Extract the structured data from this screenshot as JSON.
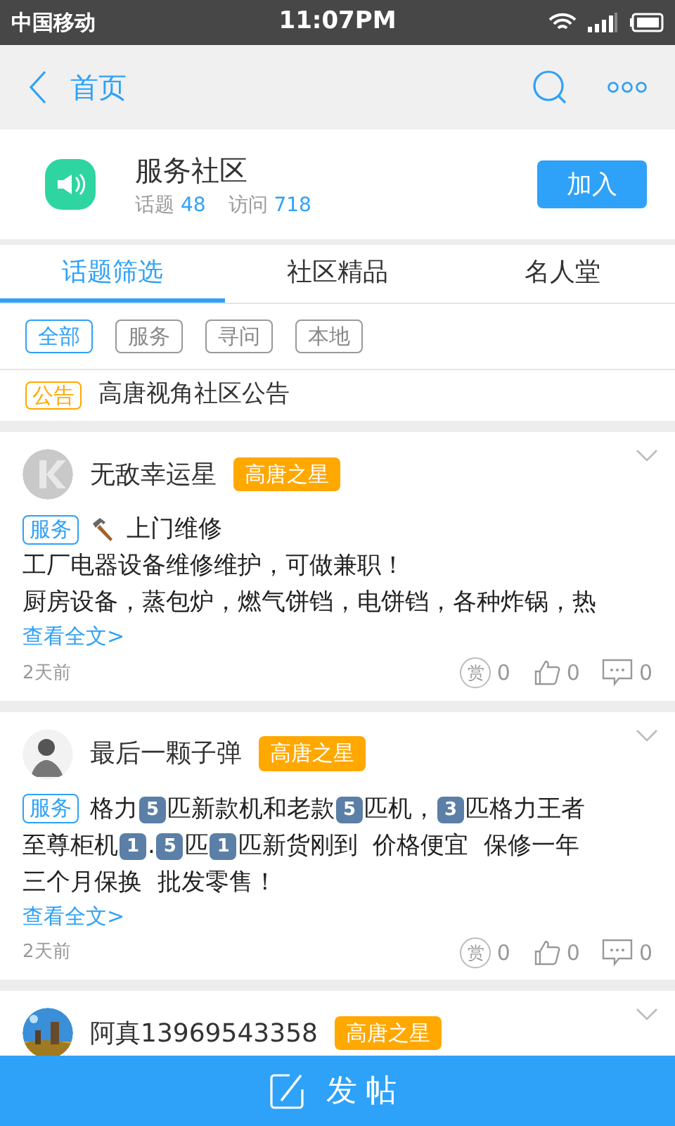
{
  "status_bar": {
    "carrier": "中国移动",
    "time": "11:07PM"
  },
  "nav": {
    "back_label": "首页"
  },
  "community": {
    "name": "服务社区",
    "topics_label": "话题",
    "topics": "48",
    "visits_label": "访问",
    "visits": "718",
    "join": "加入"
  },
  "tabs": [
    {
      "label": "话题筛选",
      "selected": true
    },
    {
      "label": "社区精品",
      "selected": false
    },
    {
      "label": "名人堂",
      "selected": false
    }
  ],
  "filters": [
    {
      "label": "全部",
      "selected": true
    },
    {
      "label": "服务",
      "selected": false
    },
    {
      "label": "寻问",
      "selected": false
    },
    {
      "label": "本地",
      "selected": false
    }
  ],
  "notice": {
    "tag": "公告",
    "text": "高唐视角社区公告"
  },
  "posts": [
    {
      "user": "无敌幸运星",
      "badge": "高唐之星",
      "tag": "服务",
      "title": "上门维修",
      "lines": [
        [
          {
            "kind": "text",
            "text": "工厂电器设备维修维护，可做兼职！"
          }
        ],
        [
          {
            "kind": "text",
            "text": "厨房设备，蒸包炉，燃气饼铛，电饼铛，各种炸锅，热"
          }
        ]
      ],
      "more": "查看全文>",
      "time": "2天前",
      "reward_label": "赏",
      "rewards": "0",
      "likes": "0",
      "comments": "0"
    },
    {
      "user": "最后一颗子弹",
      "badge": "高唐之星",
      "tag": "服务",
      "lines": [
        [
          {
            "kind": "text",
            "text": "格力"
          },
          {
            "kind": "keycap",
            "text": "5"
          },
          {
            "kind": "text",
            "text": "匹新款机和老款"
          },
          {
            "kind": "keycap",
            "text": "5"
          },
          {
            "kind": "text",
            "text": "匹机，"
          },
          {
            "kind": "keycap",
            "text": "3"
          },
          {
            "kind": "text",
            "text": "匹格力王者"
          }
        ],
        [
          {
            "kind": "text",
            "text": "至尊柜机"
          },
          {
            "kind": "keycap",
            "text": "1"
          },
          {
            "kind": "text",
            "text": "."
          },
          {
            "kind": "keycap",
            "text": "5"
          },
          {
            "kind": "text",
            "text": "匹"
          },
          {
            "kind": "keycap",
            "text": "1"
          },
          {
            "kind": "text",
            "text": "匹新货刚到  价格便宜  保修一年"
          }
        ],
        [
          {
            "kind": "text",
            "text": "三个月保换  批发零售！"
          }
        ]
      ],
      "more": "查看全文>",
      "time": "2天前",
      "reward_label": "赏",
      "rewards": "0",
      "likes": "0",
      "comments": "0"
    },
    {
      "user": "阿真13969543358",
      "badge": "高唐之星"
    }
  ],
  "post_button": "发帖"
}
